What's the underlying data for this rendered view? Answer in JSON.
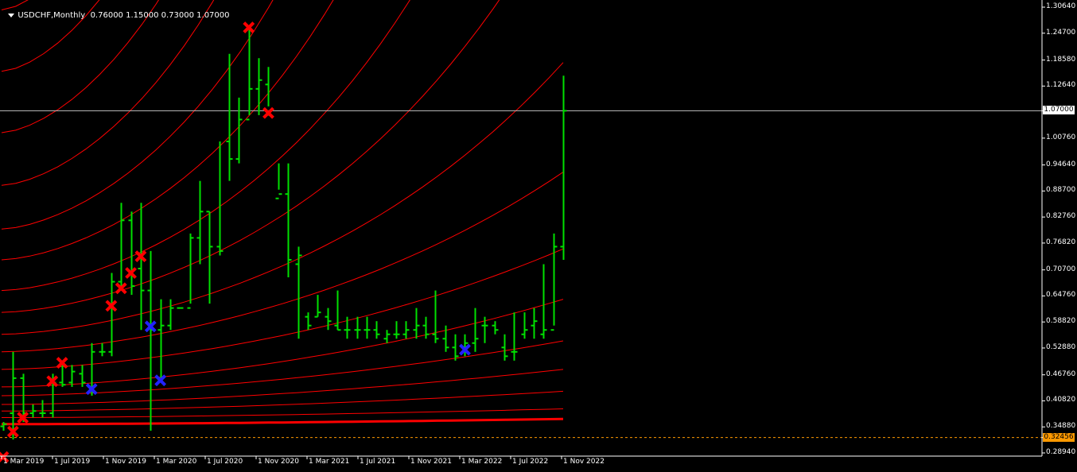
{
  "header": {
    "symbol": "USDCHF,Monthly",
    "ohlc": "0.76000 1.15000 0.73000 1.07000"
  },
  "colors": {
    "background": "#000000",
    "bars": "#00e000",
    "fan_lines": "#ff0000",
    "high_marker": "#ff0000",
    "low_marker": "#2222ff",
    "bid_line": "#c0c0c0",
    "dashed_level": "#ff9900",
    "axis_text": "#ffffff"
  },
  "chart_data": {
    "type": "ohlc",
    "symbol": "USDCHF",
    "timeframe": "Monthly",
    "y_axis_ticks": [
      "1.30640",
      "1.24700",
      "1.18580",
      "1.12640",
      "1.07000",
      "1.00760",
      "0.94640",
      "0.88700",
      "0.82760",
      "0.76820",
      "0.70700",
      "0.64760",
      "0.58820",
      "0.52880",
      "0.46760",
      "0.40820",
      "0.34880",
      "0.32456",
      "0.28940"
    ],
    "y_range": [
      0.27,
      1.31
    ],
    "x_axis_labels": [
      "1 Mar 2019",
      "1 Jul 2019",
      "1 Nov 2019",
      "1 Mar 2020",
      "1 Jul 2020",
      "1 Nov 2020",
      "1 Mar 2021",
      "1 Jul 2021",
      "1 Nov 2021",
      "1 Mar 2022",
      "1 Jul 2022",
      "1 Nov 2022"
    ],
    "current_price": 1.07,
    "dashed_level": 0.32456,
    "bars": [
      {
        "x": "2019-02",
        "o": 0.35,
        "h": 0.36,
        "l": 0.34,
        "c": 0.355
      },
      {
        "x": "2019-03",
        "o": 0.38,
        "h": 0.52,
        "l": 0.32,
        "c": 0.46
      },
      {
        "x": "2019-04",
        "o": 0.46,
        "h": 0.47,
        "l": 0.36,
        "c": 0.38
      },
      {
        "x": "2019-05",
        "o": 0.38,
        "h": 0.4,
        "l": 0.37,
        "c": 0.385
      },
      {
        "x": "2019-06",
        "o": 0.38,
        "h": 0.41,
        "l": 0.37,
        "c": 0.38
      },
      {
        "x": "2019-07",
        "o": 0.38,
        "h": 0.47,
        "l": 0.37,
        "c": 0.45
      },
      {
        "x": "2019-08",
        "o": 0.45,
        "h": 0.5,
        "l": 0.44,
        "c": 0.445
      },
      {
        "x": "2019-09",
        "o": 0.45,
        "h": 0.49,
        "l": 0.44,
        "c": 0.475
      },
      {
        "x": "2019-10",
        "o": 0.47,
        "h": 0.49,
        "l": 0.44,
        "c": 0.45
      },
      {
        "x": "2019-11",
        "o": 0.43,
        "h": 0.54,
        "l": 0.42,
        "c": 0.52
      },
      {
        "x": "2019-12",
        "o": 0.52,
        "h": 0.54,
        "l": 0.51,
        "c": 0.52
      },
      {
        "x": "2020-01",
        "o": 0.52,
        "h": 0.7,
        "l": 0.51,
        "c": 0.68
      },
      {
        "x": "2020-02",
        "o": 0.68,
        "h": 0.86,
        "l": 0.67,
        "c": 0.82
      },
      {
        "x": "2020-03",
        "o": 0.82,
        "h": 0.84,
        "l": 0.65,
        "c": 0.67
      },
      {
        "x": "2020-04",
        "o": 0.71,
        "h": 0.86,
        "l": 0.57,
        "c": 0.66
      },
      {
        "x": "2020-05",
        "o": 0.66,
        "h": 0.75,
        "l": 0.34,
        "c": 0.57
      },
      {
        "x": "2020-06",
        "o": 0.57,
        "h": 0.64,
        "l": 0.45,
        "c": 0.58
      },
      {
        "x": "2020-07",
        "o": 0.58,
        "h": 0.64,
        "l": 0.57,
        "c": 0.62
      },
      {
        "x": "2020-08",
        "o": 0.62,
        "h": 0.62,
        "l": 0.62,
        "c": 0.62
      },
      {
        "x": "2020-09",
        "o": 0.62,
        "h": 0.79,
        "l": 0.63,
        "c": 0.78
      },
      {
        "x": "2020-10",
        "o": 0.78,
        "h": 0.91,
        "l": 0.72,
        "c": 0.84
      },
      {
        "x": "2020-11",
        "o": 0.84,
        "h": 0.84,
        "l": 0.63,
        "c": 0.76
      },
      {
        "x": "2020-12",
        "o": 0.76,
        "h": 1.0,
        "l": 0.74,
        "c": 0.75
      },
      {
        "x": "2021-01",
        "o": 1.0,
        "h": 1.2,
        "l": 0.91,
        "c": 0.96
      },
      {
        "x": "2021-02",
        "o": 0.96,
        "h": 1.1,
        "l": 0.95,
        "c": 1.05
      },
      {
        "x": "2021-03",
        "o": 1.05,
        "h": 1.26,
        "l": 1.06,
        "c": 1.12
      },
      {
        "x": "2021-04",
        "o": 1.12,
        "h": 1.19,
        "l": 1.06,
        "c": 1.14
      },
      {
        "x": "2021-05",
        "o": 1.13,
        "h": 1.17,
        "l": 1.08,
        "c": 1.06
      },
      {
        "x": "2021-06",
        "o": 0.87,
        "h": 0.95,
        "l": 0.89,
        "c": 0.88
      },
      {
        "x": "2021-07",
        "o": 0.88,
        "h": 0.95,
        "l": 0.69,
        "c": 0.73
      },
      {
        "x": "2021-08",
        "o": 0.72,
        "h": 0.76,
        "l": 0.55,
        "c": 0.74
      },
      {
        "x": "2021-09",
        "o": 0.6,
        "h": 0.61,
        "l": 0.57,
        "c": 0.58
      },
      {
        "x": "2021-10",
        "o": 0.6,
        "h": 0.65,
        "l": 0.6,
        "c": 0.61
      },
      {
        "x": "2021-11",
        "o": 0.6,
        "h": 0.62,
        "l": 0.57,
        "c": 0.59
      },
      {
        "x": "2021-12",
        "o": 0.58,
        "h": 0.66,
        "l": 0.57,
        "c": 0.57
      },
      {
        "x": "2022-01",
        "o": 0.57,
        "h": 0.6,
        "l": 0.55,
        "c": 0.57
      },
      {
        "x": "2022-02",
        "o": 0.57,
        "h": 0.6,
        "l": 0.55,
        "c": 0.57
      },
      {
        "x": "2022-03",
        "o": 0.57,
        "h": 0.6,
        "l": 0.55,
        "c": 0.57
      },
      {
        "x": "2022-04",
        "o": 0.57,
        "h": 0.59,
        "l": 0.55,
        "c": 0.56
      },
      {
        "x": "2022-05",
        "o": 0.55,
        "h": 0.57,
        "l": 0.54,
        "c": 0.56
      },
      {
        "x": "2022-06",
        "o": 0.56,
        "h": 0.59,
        "l": 0.55,
        "c": 0.56
      },
      {
        "x": "2022-07",
        "o": 0.56,
        "h": 0.59,
        "l": 0.55,
        "c": 0.57
      },
      {
        "x": "2022-08",
        "o": 0.57,
        "h": 0.62,
        "l": 0.55,
        "c": 0.58
      },
      {
        "x": "2022-09",
        "o": 0.58,
        "h": 0.6,
        "l": 0.55,
        "c": 0.56
      },
      {
        "x": "2022-10",
        "o": 0.56,
        "h": 0.66,
        "l": 0.54,
        "c": 0.55
      },
      {
        "x": "2022-11",
        "o": 0.55,
        "h": 0.58,
        "l": 0.52,
        "c": 0.53
      },
      {
        "x": "2022-12",
        "o": 0.53,
        "h": 0.56,
        "l": 0.5,
        "c": 0.51
      },
      {
        "x": "2023-01",
        "o": 0.53,
        "h": 0.56,
        "l": 0.51,
        "c": 0.54
      },
      {
        "x": "2023-02",
        "o": 0.54,
        "h": 0.62,
        "l": 0.52,
        "c": 0.55
      },
      {
        "x": "2023-03",
        "o": 0.58,
        "h": 0.6,
        "l": 0.54,
        "c": 0.58
      },
      {
        "x": "2023-04",
        "o": 0.58,
        "h": 0.59,
        "l": 0.56,
        "c": 0.57
      },
      {
        "x": "2023-05",
        "o": 0.53,
        "h": 0.56,
        "l": 0.5,
        "c": 0.51
      },
      {
        "x": "2023-06",
        "o": 0.52,
        "h": 0.61,
        "l": 0.5,
        "c": 0.52
      },
      {
        "x": "2023-07",
        "o": 0.56,
        "h": 0.61,
        "l": 0.55,
        "c": 0.57
      },
      {
        "x": "2023-08",
        "o": 0.58,
        "h": 0.62,
        "l": 0.55,
        "c": 0.59
      },
      {
        "x": "2023-09",
        "o": 0.56,
        "h": 0.72,
        "l": 0.55,
        "c": 0.57
      },
      {
        "x": "2023-10",
        "o": 0.57,
        "h": 0.79,
        "l": 0.58,
        "c": 0.76
      },
      {
        "x": "2023-11",
        "o": 0.76,
        "h": 1.15,
        "l": 0.73,
        "c": 1.07
      }
    ],
    "fan_arcs": [
      {
        "start": 0.355,
        "end": 0.367
      },
      {
        "start": 0.37,
        "end": 0.39
      },
      {
        "start": 0.385,
        "end": 0.43
      },
      {
        "start": 0.4,
        "end": 0.48
      },
      {
        "start": 0.42,
        "end": 0.545
      },
      {
        "start": 0.44,
        "end": 0.64
      },
      {
        "start": 0.48,
        "end": 0.755
      },
      {
        "start": 0.52,
        "end": 0.93
      },
      {
        "start": 0.56,
        "end": 1.18
      },
      {
        "start": 0.61,
        "end": 1.56
      },
      {
        "start": 0.66,
        "end": 2.1
      },
      {
        "start": 0.73,
        "end": 2.9
      },
      {
        "start": 0.8,
        "end": 4.0
      },
      {
        "start": 0.9,
        "end": 5.6
      },
      {
        "start": 1.02,
        "end": 7.5
      },
      {
        "start": 1.16,
        "end": 10.0
      },
      {
        "start": 1.3,
        "end": 13.0
      }
    ],
    "markers": [
      {
        "type": "high",
        "x": "2019-03",
        "y": 0.338
      },
      {
        "type": "high",
        "x": "2019-04",
        "y": 0.37
      },
      {
        "type": "high",
        "x": "2019-07",
        "y": 0.453
      },
      {
        "type": "high",
        "x": "2019-08",
        "y": 0.495
      },
      {
        "type": "low",
        "x": "2019-11",
        "y": 0.435
      },
      {
        "type": "high",
        "x": "2020-01",
        "y": 0.625
      },
      {
        "type": "high",
        "x": "2020-02",
        "y": 0.665
      },
      {
        "type": "high",
        "x": "2020-03",
        "y": 0.7
      },
      {
        "type": "high",
        "x": "2020-04",
        "y": 0.738
      },
      {
        "type": "low",
        "x": "2020-05",
        "y": 0.578
      },
      {
        "type": "low",
        "x": "2020-06",
        "y": 0.455
      },
      {
        "type": "high",
        "x": "2021-03",
        "y": 1.26
      },
      {
        "type": "high",
        "x": "2021-05",
        "y": 1.065
      },
      {
        "type": "low",
        "x": "2023-01",
        "y": 0.525
      },
      {
        "type": "high",
        "x": "2019-02",
        "y": 0.28
      }
    ]
  }
}
